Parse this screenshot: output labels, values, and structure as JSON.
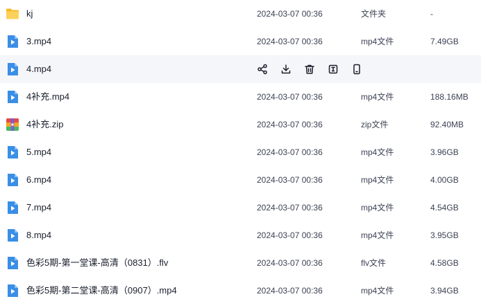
{
  "files": [
    {
      "name": "kj",
      "date": "2024-03-07 00:36",
      "type": "文件夹",
      "size": "-",
      "icon": "folder-icon"
    },
    {
      "name": "3.mp4",
      "date": "2024-03-07 00:36",
      "type": "mp4文件",
      "size": "7.49GB",
      "icon": "video-file-icon"
    },
    {
      "name": "4.mp4",
      "date": "",
      "type": "",
      "size": "",
      "icon": "video-file-icon",
      "hovered": true
    },
    {
      "name": "4补充.mp4",
      "date": "2024-03-07 00:36",
      "type": "mp4文件",
      "size": "188.16MB",
      "icon": "video-file-icon"
    },
    {
      "name": "4补充.zip",
      "date": "2024-03-07 00:36",
      "type": "zip文件",
      "size": "92.40MB",
      "icon": "zip-file-icon"
    },
    {
      "name": "5.mp4",
      "date": "2024-03-07 00:36",
      "type": "mp4文件",
      "size": "3.96GB",
      "icon": "video-file-icon"
    },
    {
      "name": "6.mp4",
      "date": "2024-03-07 00:36",
      "type": "mp4文件",
      "size": "4.00GB",
      "icon": "video-file-icon"
    },
    {
      "name": "7.mp4",
      "date": "2024-03-07 00:36",
      "type": "mp4文件",
      "size": "4.54GB",
      "icon": "video-file-icon"
    },
    {
      "name": "8.mp4",
      "date": "2024-03-07 00:36",
      "type": "mp4文件",
      "size": "3.95GB",
      "icon": "video-file-icon"
    },
    {
      "name": "色彩5期-第一堂课-高清（0831）.flv",
      "date": "2024-03-07 00:36",
      "type": "flv文件",
      "size": "4.58GB",
      "icon": "video-file-icon"
    },
    {
      "name": "色彩5期-第二堂课-高清（0907）.mp4",
      "date": "2024-03-07 00:36",
      "type": "mp4文件",
      "size": "3.94GB",
      "icon": "video-file-icon"
    }
  ],
  "row_actions": [
    "share-icon",
    "download-icon",
    "delete-icon",
    "rename-icon",
    "mobile-icon"
  ],
  "colors": {
    "accent": "#3a8ee6",
    "folder": "#f7c548",
    "hover_bg": "#f5f6f9",
    "text": "#3c4254"
  }
}
